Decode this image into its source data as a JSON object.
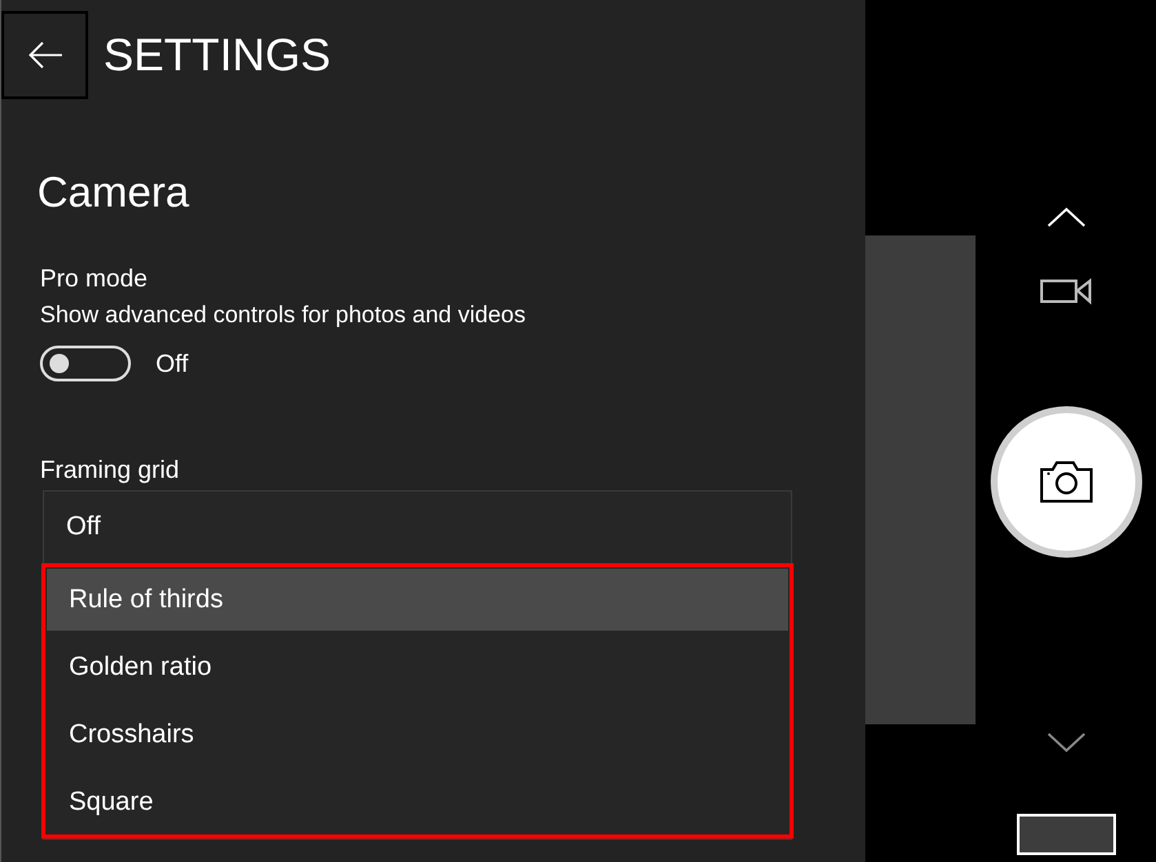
{
  "header": {
    "title": "SETTINGS"
  },
  "section": {
    "title": "Camera"
  },
  "pro_mode": {
    "label": "Pro mode",
    "description": "Show advanced controls for photos and videos",
    "on": false,
    "state_text": "Off"
  },
  "framing_grid": {
    "label": "Framing grid",
    "expanded": true,
    "options": [
      {
        "label": "Off",
        "selected": false,
        "highlighted": false
      },
      {
        "label": "Rule of thirds",
        "selected": true,
        "highlighted": true
      },
      {
        "label": "Golden ratio",
        "selected": false,
        "highlighted": true
      },
      {
        "label": "Crosshairs",
        "selected": false,
        "highlighted": true
      },
      {
        "label": "Square",
        "selected": false,
        "highlighted": true
      }
    ]
  }
}
